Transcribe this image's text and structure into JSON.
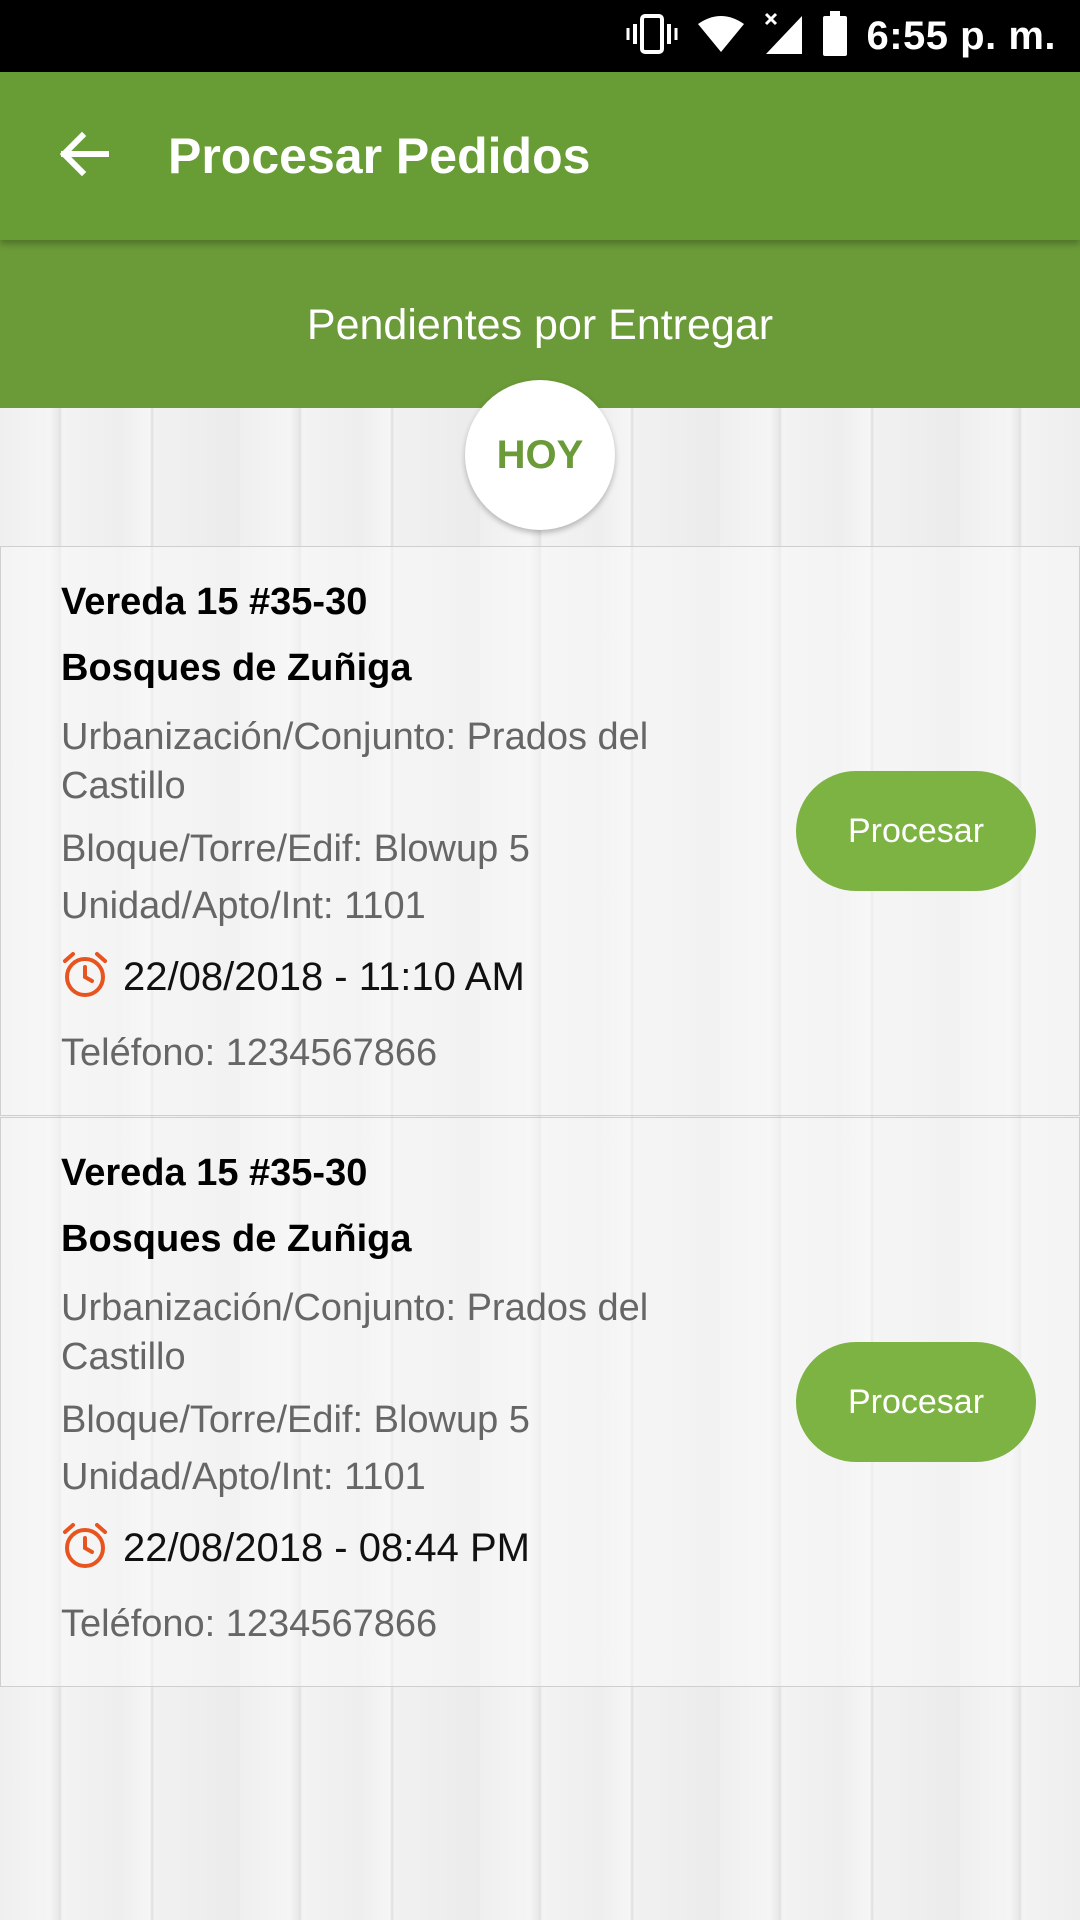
{
  "status_bar": {
    "time": "6:55 p. m.",
    "icons": [
      "vibrate-icon",
      "wifi-icon",
      "signal-icon",
      "battery-icon"
    ]
  },
  "app_bar": {
    "back_icon": "arrow-back-icon",
    "title": "Procesar Pedidos"
  },
  "sub_header": {
    "title": "Pendientes por Entregar"
  },
  "day_badge": {
    "label": "HOY"
  },
  "colors": {
    "app_bar": "#689c35",
    "sub_header": "#6b9a38",
    "button": "#7cb342",
    "clock_icon": "#e8541f"
  },
  "orders": [
    {
      "address": "Vereda 15 #35-30",
      "neighborhood": "Bosques de Zuñiga",
      "complex": "Urbanización/Conjunto: Prados del Castillo",
      "block": "Bloque/Torre/Edif: Blowup 5",
      "unit": "Unidad/Apto/Int: 1101",
      "datetime": "22/08/2018 - 11:10 AM",
      "phone": "Teléfono: 1234567866",
      "button_label": "Procesar"
    },
    {
      "address": "Vereda 15 #35-30",
      "neighborhood": "Bosques de Zuñiga",
      "complex": "Urbanización/Conjunto: Prados del Castillo",
      "block": "Bloque/Torre/Edif: Blowup 5",
      "unit": "Unidad/Apto/Int: 1101",
      "datetime": "22/08/2018 - 08:44 PM",
      "phone": "Teléfono: 1234567866",
      "button_label": "Procesar"
    }
  ]
}
